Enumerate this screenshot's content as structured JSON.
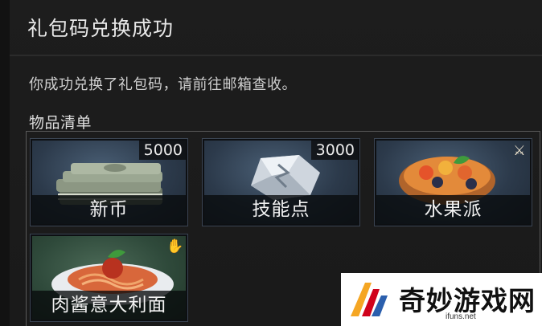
{
  "dialog": {
    "title": "礼包码兑换成功",
    "message": "你成功兑换了礼包码，请前往邮箱查收。",
    "list_heading": "物品清单"
  },
  "items": [
    {
      "name": "新币",
      "quantity": "5000",
      "badge_icon": null
    },
    {
      "name": "技能点",
      "quantity": "3000",
      "badge_icon": null
    },
    {
      "name": "水果派",
      "quantity": null,
      "badge_icon": "crossed-tools-icon"
    },
    {
      "name": "肉酱意大利面",
      "quantity": null,
      "badge_icon": "cooking-hand-icon"
    }
  ],
  "watermark": {
    "text": "奇妙游戏网",
    "url": "ifuns.net"
  },
  "colors": {
    "background": "#1b1b1b",
    "item_border": "#3a4452",
    "name_bar": "#080a0c"
  }
}
